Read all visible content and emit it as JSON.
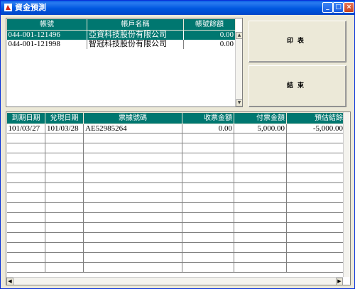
{
  "window": {
    "title": "資金預測"
  },
  "accounts": {
    "columns": [
      "帳號",
      "帳戶名稱",
      "帳號餘額"
    ],
    "rows": [
      {
        "account": "044-001-121496",
        "name": "亞資科技股份有限公司",
        "balance": "0.00",
        "selected": true
      },
      {
        "account": "044-001-121998",
        "name": "智冠科技股份有限公司",
        "balance": "0.00",
        "selected": false
      }
    ]
  },
  "buttons": {
    "print": "印表",
    "exit": "結束"
  },
  "transactions": {
    "columns": [
      "到期日期",
      "兌現日期",
      "票據號碼",
      "收票金額",
      "付票金額",
      "預估結餘"
    ],
    "rows": [
      {
        "due_date": "101/03/27",
        "cash_date": "101/03/28",
        "note_no": "AE52985264",
        "receive": "0.00",
        "pay": "5,000.00",
        "balance": "-5,000.00"
      }
    ]
  },
  "icons": {
    "app": "app-icon",
    "minimize": "minimize-icon",
    "maximize": "maximize-icon",
    "close": "close-icon"
  },
  "colors": {
    "header_bg": "#007770",
    "titlebar": "#0058e0"
  }
}
